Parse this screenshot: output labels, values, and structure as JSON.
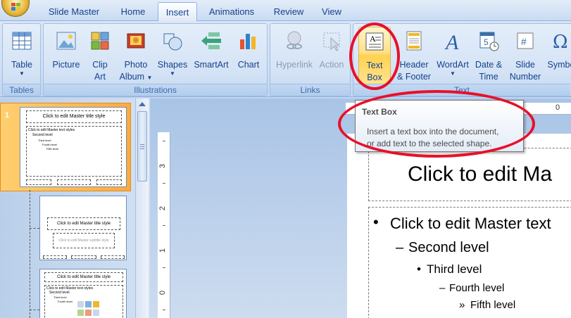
{
  "tabs": [
    {
      "label": "Slide Master",
      "active": false
    },
    {
      "label": "Home",
      "active": false
    },
    {
      "label": "Insert",
      "active": true
    },
    {
      "label": "Animations",
      "active": false
    },
    {
      "label": "Review",
      "active": false
    },
    {
      "label": "View",
      "active": false
    }
  ],
  "ribbon": {
    "groups": {
      "tables": "Tables",
      "illustrations": "Illustrations",
      "links": "Links",
      "text": "Text"
    },
    "buttons": {
      "table": "Table",
      "picture": "Picture",
      "clip_art_1": "Clip",
      "clip_art_2": "Art",
      "photo_album_1": "Photo",
      "photo_album_2": "Album",
      "shapes": "Shapes",
      "smartart": "SmartArt",
      "chart": "Chart",
      "hyperlink": "Hyperlink",
      "action": "Action",
      "text_box_1": "Text",
      "text_box_2": "Box",
      "header_footer_1": "Header",
      "header_footer_2": "& Footer",
      "wordart": "WordArt",
      "date_time_1": "Date &",
      "date_time_2": "Time",
      "slide_number_1": "Slide",
      "slide_number_2": "Number",
      "symbol": "Symbo"
    }
  },
  "tooltip": {
    "title": "Text Box",
    "body_1": "Insert a text box into the document,",
    "body_2": "or add text to the selected shape."
  },
  "slides_panel": {
    "selected_number": "1",
    "thumb1_title": "Click to edit Master title style",
    "thumb1_body": [
      "Click to edit Master text styles",
      "Second level",
      "Third level",
      "Fourth level",
      "Fifth level"
    ],
    "thumb2_title": "Click to edit Master title style",
    "thumb2_subtitle": "Click to edit Master subtitle style",
    "thumb3_title": "Click to edit Master title style",
    "thumb3_body": [
      "Click to edit Master text styles",
      "Second level",
      "Third level",
      "Fourth level"
    ]
  },
  "ruler": {
    "vertical": [
      "3",
      "2",
      "1",
      "0"
    ],
    "horizontal": "0"
  },
  "slide": {
    "title": "Click to edit Ma",
    "levels": [
      {
        "bullet": "•",
        "text": "Click to edit Master text"
      },
      {
        "bullet": "–",
        "text": "Second level"
      },
      {
        "bullet": "•",
        "text": "Third level"
      },
      {
        "bullet": "–",
        "text": "Fourth level"
      },
      {
        "bullet": "»",
        "text": "Fifth level"
      }
    ]
  },
  "colors": {
    "annotation_red": "#e8102a",
    "hover_yellow": "#ffd24f",
    "ribbon_text": "#15428b"
  }
}
